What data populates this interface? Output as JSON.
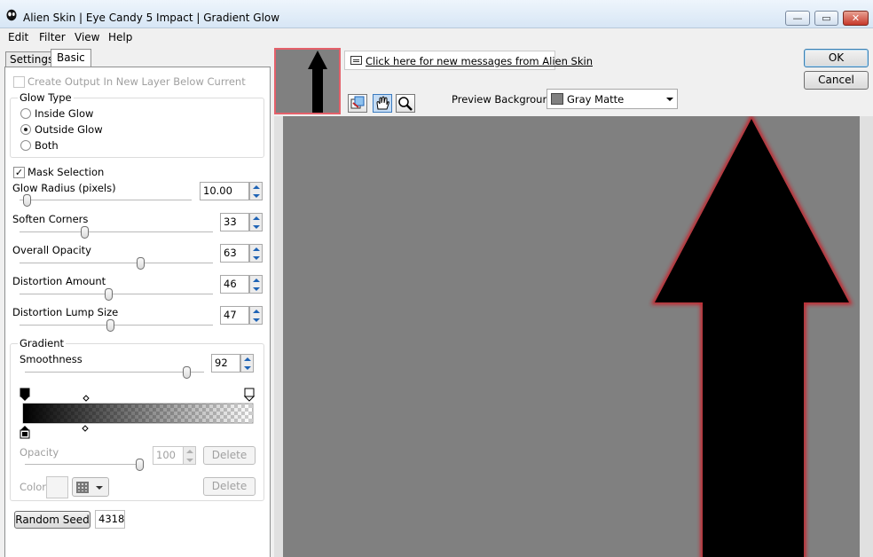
{
  "window": {
    "title": "Alien Skin | Eye Candy 5 Impact | Gradient Glow"
  },
  "caption_buttons": {
    "minimize": "—",
    "maximize": "▭",
    "close": "✕"
  },
  "menu": [
    "Edit",
    "Filter",
    "View",
    "Help"
  ],
  "tabs": {
    "settings": "Settings",
    "basic": "Basic",
    "active": "Basic"
  },
  "create_output": {
    "label": "Create Output In New Layer Below Current",
    "checked": false,
    "enabled": false
  },
  "glow_type": {
    "title": "Glow Type",
    "options": [
      "Inside Glow",
      "Outside Glow",
      "Both"
    ],
    "selected": "Outside Glow"
  },
  "mask_selection": {
    "label": "Mask Selection",
    "checked": true,
    "checkmark": "✓"
  },
  "sliders": [
    {
      "label": "Glow Radius (pixels)",
      "value": "10.00",
      "fraction": 0.02
    },
    {
      "label": "Soften Corners",
      "value": "33",
      "fraction": 0.33
    },
    {
      "label": "Overall Opacity",
      "value": "63",
      "fraction": 0.63
    },
    {
      "label": "Distortion Amount",
      "value": "46",
      "fraction": 0.46
    },
    {
      "label": "Distortion Lump Size",
      "value": "47",
      "fraction": 0.47
    }
  ],
  "gradient": {
    "title": "Gradient",
    "smoothness": {
      "label": "Smoothness",
      "value": "92",
      "fraction": 0.92
    },
    "opacity": {
      "label": "Opacity",
      "value": "100",
      "fraction": 1.0,
      "enabled": false
    },
    "color_label": "Color",
    "delete_label": "Delete"
  },
  "random_seed": {
    "label": "Random Seed",
    "value": "4318"
  },
  "message_link": "Click here for new messages from Alien Skin",
  "tools": [
    "preview-navigate-icon",
    "hand-icon",
    "zoom-icon"
  ],
  "preview_background": {
    "label": "Preview Background:",
    "value": "Gray Matte",
    "swatch_color": "#808080"
  },
  "buttons": {
    "ok": "OK",
    "cancel": "Cancel"
  },
  "colors": {
    "canvas": "#808080",
    "glow": "#c8202a",
    "shape": "#000000",
    "accent": "#3c7fb1"
  }
}
